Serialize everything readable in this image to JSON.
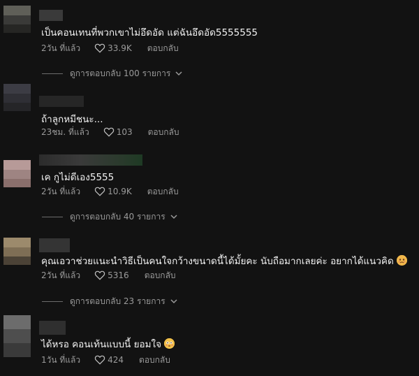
{
  "comments": [
    {
      "text": "เป็นคอนเทนที่พวกเขาไม่อึดอัด แต่ฉันอึดอัด5555555",
      "time": "2วัน ที่แล้ว",
      "likes": "33.9K",
      "reply": "ตอบกลับ",
      "view_replies": "ดูการตอบกลับ 100 รายการ",
      "avatar_colors": [
        "#5f5f58",
        "#3a3a38",
        "#262624"
      ]
    },
    {
      "text": "ถ้าลูกหมีชนะ...",
      "time": "23ชม. ที่แล้ว",
      "likes": "103",
      "reply": "ตอบกลับ",
      "avatar_colors": [
        "#3c3c44",
        "#2f2f35",
        "#252528"
      ]
    },
    {
      "text": "เค กูไม่ดีเอง5555",
      "time": "2วัน ที่แล้ว",
      "likes": "10.9K",
      "reply": "ตอบกลับ",
      "view_replies": "ดูการตอบกลับ 40 รายการ",
      "avatar_colors": [
        "#b79a98",
        "#9e8482",
        "#8a6f6c"
      ]
    },
    {
      "text": "คุณเอวาช่วยแนะนำวิธีเป็นคนใจกว้างขนาดนี้ได้มั้ยคะ นับถือมากเลยค่ะ อยากได้แนวคิด",
      "emoji": "sad-face-emoji",
      "time": "2วัน ที่แล้ว",
      "likes": "5316",
      "reply": "ตอบกลับ",
      "view_replies": "ดูการตอบกลับ 23 รายการ",
      "avatar_colors": [
        "#9c8a6c",
        "#7e6e55",
        "#4b4236"
      ]
    },
    {
      "text": "ได้หรอ คอนเท้นแบบนี้ ยอมใจ",
      "emoji": "flushed-face-emoji",
      "time": "1วัน ที่แล้ว",
      "likes": "424",
      "reply": "ตอบกลับ",
      "avatar_colors": [
        "#6c6c6c",
        "#4e4e4e",
        "#3a3a3a"
      ]
    }
  ],
  "colors": {
    "background": "#121212",
    "text": "#f2f2f2",
    "meta": "#9a9a9a"
  }
}
